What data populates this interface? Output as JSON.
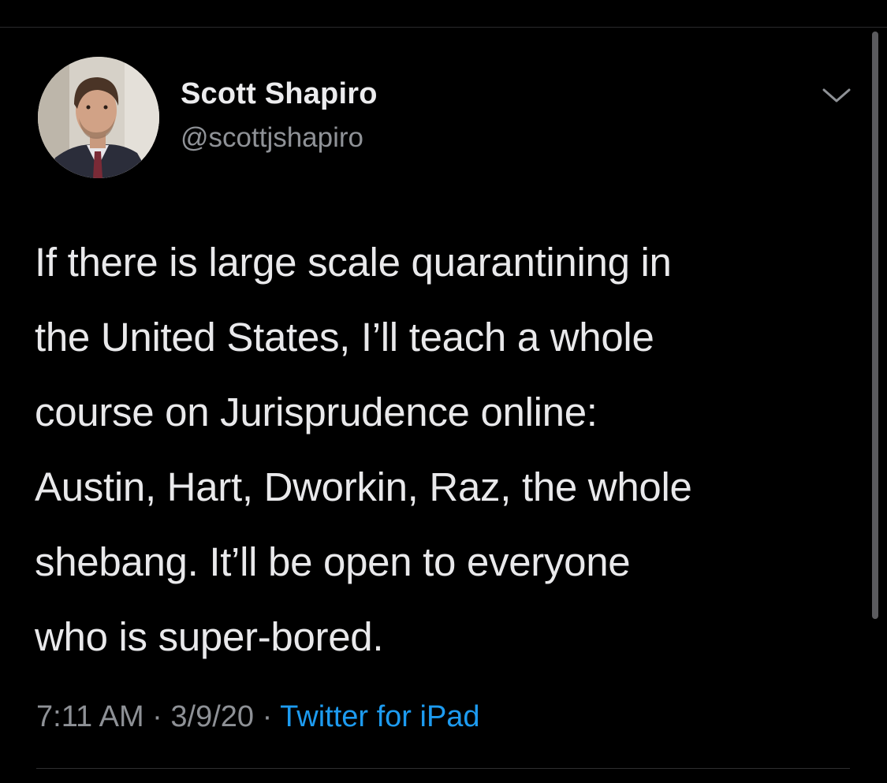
{
  "tweet": {
    "author": {
      "display_name": "Scott Shapiro",
      "handle": "@scottjshapiro",
      "avatar_icon": "profile-photo"
    },
    "text": "If there is large scale quarantining in\nthe United States, I’ll teach a whole\ncourse on Jurisprudence online:\nAustin, Hart, Dworkin, Raz, the whole\nshebang. It’ll be open to everyone\nwho is super-bored.",
    "time": "7:11 AM",
    "separator": "·",
    "date": "3/9/20",
    "source": "Twitter for iPad"
  },
  "icons": {
    "menu": "chevron-down-icon"
  },
  "colors": {
    "background": "#000000",
    "text": "#e9e9eb",
    "secondary_text": "#8e9196",
    "link": "#1d9bf0"
  }
}
